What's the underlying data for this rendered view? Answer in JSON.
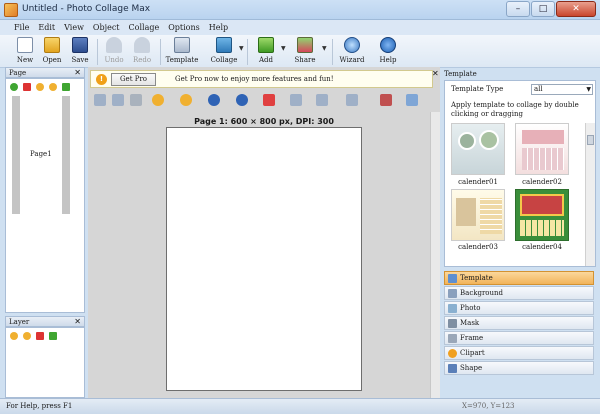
{
  "window": {
    "title": "Untitled - Photo Collage Max",
    "min": "–",
    "max": "□",
    "close": "✕"
  },
  "menu": [
    "File",
    "Edit",
    "View",
    "Object",
    "Collage",
    "Options",
    "Help"
  ],
  "toolbar": {
    "new": "New",
    "open": "Open",
    "save": "Save",
    "undo": "Undo",
    "redo": "Redo",
    "template": "Template",
    "collage": "Collage",
    "add": "Add",
    "share": "Share",
    "wizard": "Wizard",
    "help": "Help"
  },
  "page_panel": {
    "title": "Page",
    "close": "✕",
    "thumb_label": "Page1"
  },
  "layer_panel": {
    "title": "Layer",
    "close": "✕"
  },
  "notice": {
    "button": "Get Pro",
    "message": "Get Pro now to enjoy more features and fun!",
    "info": "!"
  },
  "canvas": {
    "page_info": "Page 1: 600 × 800 px, DPI: 300"
  },
  "template_panel": {
    "title": "Template",
    "close": "✕",
    "type_label": "Template Type",
    "type_value": "all",
    "apply_text": "Apply template to collage by double clicking or dragging",
    "items": [
      "calender01",
      "calender02",
      "calender03",
      "calender04"
    ]
  },
  "categories": [
    "Template",
    "Background",
    "Photo",
    "Mask",
    "Frame",
    "Clipart",
    "Shape"
  ],
  "status": {
    "help": "For Help, press F1",
    "coord": "X=970, Y=123"
  },
  "colors": {
    "accent": "#f2b35a",
    "title_bar": "#b9d3ef",
    "canvas_bg": "#d6d6d6"
  }
}
